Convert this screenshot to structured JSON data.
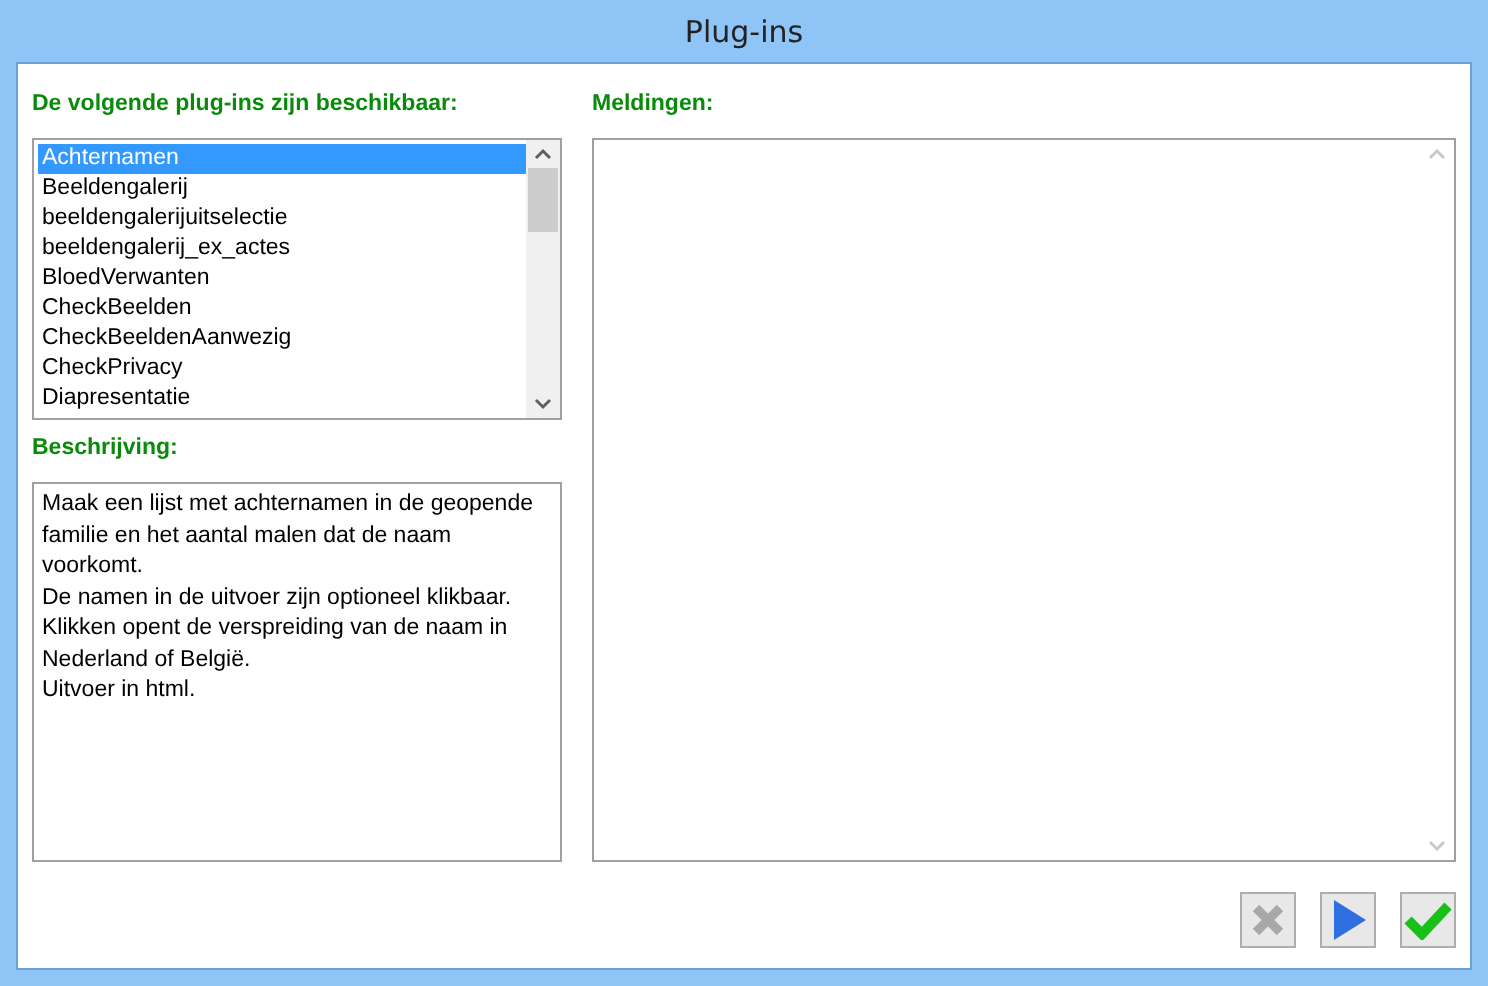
{
  "window": {
    "title": "Plug-ins"
  },
  "plugins": {
    "label": "De volgende plug-ins zijn beschikbaar:",
    "items": [
      {
        "label": "Achternamen",
        "selected": true
      },
      {
        "label": "Beeldengalerij",
        "selected": false
      },
      {
        "label": "beeldengalerijuitselectie",
        "selected": false
      },
      {
        "label": "beeldengalerij_ex_actes",
        "selected": false
      },
      {
        "label": "BloedVerwanten",
        "selected": false
      },
      {
        "label": "CheckBeelden",
        "selected": false
      },
      {
        "label": "CheckBeeldenAanwezig",
        "selected": false
      },
      {
        "label": "CheckPrivacy",
        "selected": false
      },
      {
        "label": "Diapresentatie",
        "selected": false
      }
    ]
  },
  "description": {
    "label": "Beschrijving:",
    "paragraphs": [
      "Maak een lijst met achternamen in de geopende familie en het aantal malen dat de naam voorkomt.",
      "De namen in de uitvoer zijn optioneel klikbaar.",
      "Klikken opent de verspreiding van de naam in Nederland of België.",
      "Uitvoer in html."
    ]
  },
  "messages": {
    "label": "Meldingen:"
  },
  "buttons": [
    {
      "kind": "cancel",
      "disabled": true
    },
    {
      "kind": "run",
      "disabled": false
    },
    {
      "kind": "ok",
      "disabled": false
    }
  ]
}
